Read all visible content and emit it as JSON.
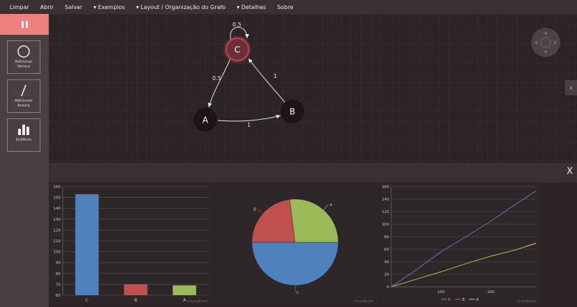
{
  "menu": {
    "items": [
      "Limpar",
      "Abrir",
      "Salvar",
      "▾ Exemplos",
      "▾ Layout / Organização do Grafo",
      "▾ Detalhes",
      "Sobre"
    ]
  },
  "sidebar": {
    "tools": [
      {
        "label": "Adicionar\nVértice",
        "icon": "circle-icon"
      },
      {
        "label": "Adicionar\nAresta",
        "icon": "line-icon"
      },
      {
        "label": "Gráficos",
        "icon": "bar-chart-icon"
      }
    ]
  },
  "graph": {
    "nodes": [
      {
        "id": "C",
        "highlight": true
      },
      {
        "id": "A",
        "highlight": false
      },
      {
        "id": "B",
        "highlight": false
      }
    ],
    "edges": [
      {
        "from": "C",
        "to": "C",
        "label": "0.5"
      },
      {
        "from": "C",
        "to": "A",
        "label": "0.5"
      },
      {
        "from": "B",
        "to": "C",
        "label": "1"
      },
      {
        "from": "A",
        "to": "B",
        "label": "1"
      }
    ],
    "colors": {
      "node": "#1c1416",
      "highlight_stroke": "#c04050",
      "edge": "#e8e8e8"
    }
  },
  "panel": {
    "close_label": "X"
  },
  "chart_data": [
    {
      "type": "bar",
      "categories": [
        "C",
        "B",
        "A"
      ],
      "values": [
        153,
        70,
        69
      ],
      "colors": [
        "#4f81bd",
        "#c0504d",
        "#9bbb59"
      ],
      "ylim": [
        60,
        160
      ],
      "yticks": [
        60,
        70,
        80,
        90,
        100,
        110,
        120,
        130,
        140,
        150,
        160
      ],
      "watermark": "CanvasJS.com"
    },
    {
      "type": "pie",
      "labels": [
        "C",
        "B",
        "A"
      ],
      "values": [
        50,
        23,
        27
      ],
      "colors": [
        "#4f81bd",
        "#c0504d",
        "#9bbb59"
      ],
      "watermark": "CanvasJS.com"
    },
    {
      "type": "line",
      "xlim": [
        0,
        290
      ],
      "ylim": [
        0,
        160
      ],
      "xticks": [
        100,
        200
      ],
      "yticks": [
        0,
        20,
        40,
        60,
        80,
        100,
        120,
        140,
        160
      ],
      "series": [
        {
          "name": "C",
          "color": "#4f81bd",
          "x": [
            0,
            50,
            100,
            150,
            200,
            250,
            290
          ],
          "y": [
            0,
            27,
            56,
            80,
            105,
            132,
            153
          ]
        },
        {
          "name": "B",
          "color": "#c0504d",
          "x": [
            0,
            50,
            100,
            150,
            200,
            250,
            290
          ],
          "y": [
            0,
            12,
            24,
            37,
            49,
            59,
            69
          ]
        },
        {
          "name": "A",
          "color": "#9bbb59",
          "x": [
            0,
            50,
            100,
            150,
            200,
            250,
            290
          ],
          "y": [
            0,
            12,
            24,
            37,
            49,
            59,
            70
          ]
        }
      ],
      "watermark": "CanvasJS.com"
    }
  ]
}
